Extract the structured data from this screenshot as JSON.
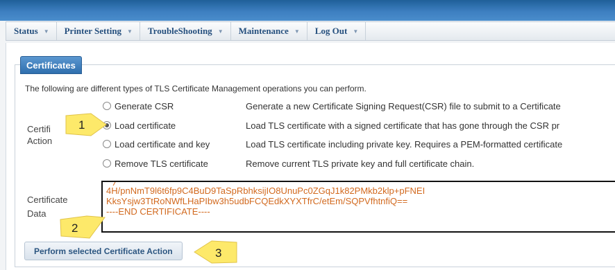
{
  "nav": {
    "items": [
      {
        "label": "Status"
      },
      {
        "label": "Printer Setting"
      },
      {
        "label": "TroubleShooting"
      },
      {
        "label": "Maintenance"
      },
      {
        "label": "Log Out"
      }
    ],
    "caret": "▼"
  },
  "panel": {
    "tab_label": "Certificates",
    "intro": "The following are different types of TLS Certificate Management operations you can perform.",
    "action_label_line1": "Certifi",
    "action_label_line2": "Action",
    "data_label_line1": "Certificate",
    "data_label_line2": "Data"
  },
  "options": [
    {
      "label": "Generate CSR",
      "desc": "Generate a new Certificate Signing Request(CSR) file to submit to a Certificate",
      "checked": false
    },
    {
      "label": "Load certificate",
      "desc": "Load TLS certificate with a signed certificate that has gone through the CSR pr",
      "checked": true
    },
    {
      "label": "Load certificate and key",
      "desc": "Load TLS certificate including private key. Requires a PEM-formatted certificate",
      "checked": false
    },
    {
      "label": "Remove TLS certificate",
      "desc": "Remove current TLS private key and full certificate chain.",
      "checked": false
    }
  ],
  "certificate": {
    "lines": [
      "4H/pnNmT9l6t6fp9C4BuD9TaSpRbhksijIO8UnuPc0ZGqJ1k82PMkb2klp+pFNEI",
      "KksYsjw3TtRoNWfLHaPIbw3h5udbFCQEdkXYXTfrC/etEm/SQPVfhtnfiQ==",
      "----END CERTIFICATE----"
    ]
  },
  "submit_label": "Perform selected Certificate Action",
  "callouts": [
    "1",
    "2",
    "3"
  ],
  "colors": {
    "topbar": "#2f6fae",
    "nav_text": "#26507e",
    "tab_bg": "#3a7bbf",
    "cert_text": "#d2691e",
    "callout_fill": "#fde96a"
  }
}
